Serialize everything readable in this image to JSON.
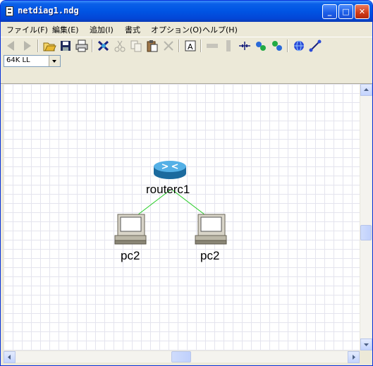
{
  "window": {
    "title": "netdiag1.ndg"
  },
  "title_buttons": {
    "minimize": "_",
    "maximize": "□",
    "close": "✕"
  },
  "menu": [
    "ファイル(F)",
    "編集(E)",
    "追加(I)",
    "書式",
    "オプション(O)",
    "ヘルプ(H)"
  ],
  "toolbar": {
    "icons": [
      "back-arrow-icon",
      "forward-arrow-icon",
      "open-folder-icon",
      "save-icon",
      "print-icon",
      "connect-icon",
      "cut-icon",
      "copy-icon",
      "paste-icon",
      "delete-icon",
      "text-icon",
      "horizontal-bar-icon",
      "vertical-bar-icon",
      "link-tool-icon",
      "group-icon",
      "ungroup-icon",
      "globe-icon",
      "line-tool-icon"
    ]
  },
  "bandwidth_select": {
    "value": "64K LL"
  },
  "diagram": {
    "nodes": [
      {
        "id": "router",
        "type": "router",
        "label": "routerc1"
      },
      {
        "id": "pc_left",
        "type": "pc",
        "label": "pc2"
      },
      {
        "id": "pc_right",
        "type": "pc",
        "label": "pc2"
      }
    ],
    "links": [
      {
        "from": "router",
        "to": "pc_left"
      },
      {
        "from": "router",
        "to": "pc_right"
      }
    ],
    "link_color": "#22cc22"
  }
}
